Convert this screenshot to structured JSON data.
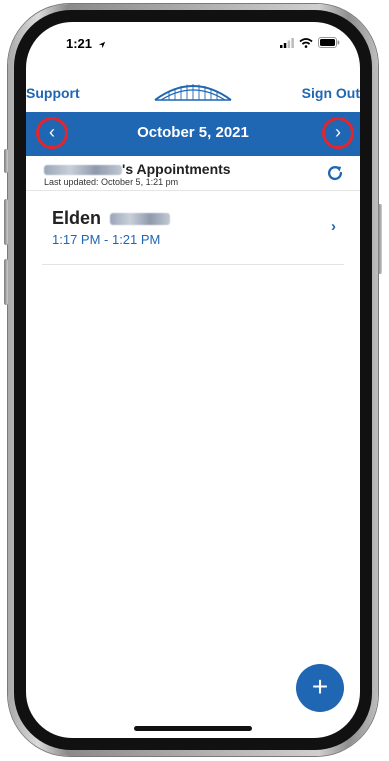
{
  "status": {
    "time": "1:21"
  },
  "topbar": {
    "support_label": "Support",
    "signout_label": "Sign Out"
  },
  "datebar": {
    "date": "October 5, 2021",
    "prev_glyph": "‹",
    "next_glyph": "›"
  },
  "appointments": {
    "title_suffix": "'s Appointments",
    "last_updated": "Last updated: October 5, 1:21 pm",
    "items": [
      {
        "first_name": "Elden",
        "time_range": "1:17 PM - 1:21 PM"
      }
    ]
  },
  "fab": {
    "label": "+"
  },
  "colors": {
    "brand_blue": "#1f66b3",
    "highlight_red": "#e0262e"
  },
  "icons": {
    "logo": "bridge-logo-icon",
    "refresh": "refresh-icon",
    "chevron": "chevron-right-icon",
    "location": "location-arrow-icon"
  }
}
